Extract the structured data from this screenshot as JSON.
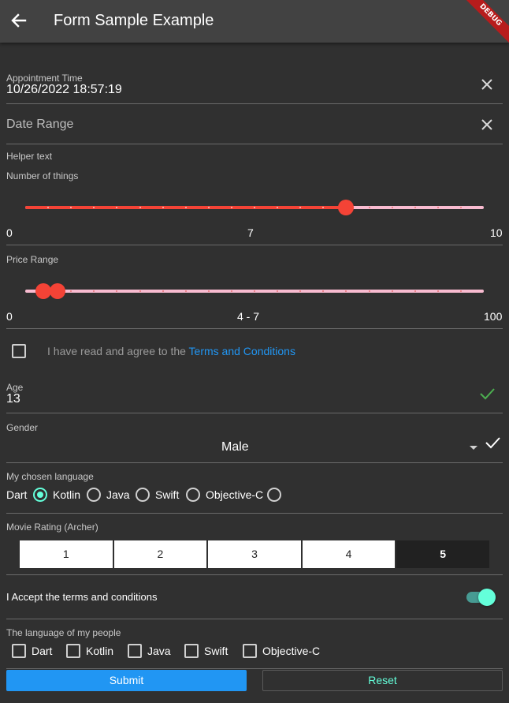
{
  "appbar": {
    "title": "Form Sample Example",
    "debug_label": "DEBUG"
  },
  "appointment": {
    "label": "Appointment Time",
    "value": "10/26/2022 18:57:19"
  },
  "date_range": {
    "placeholder": "Date Range",
    "helper": "Helper text"
  },
  "number_slider": {
    "label": "Number of things",
    "min_label": "0",
    "value_label": "7",
    "max_label": "10",
    "value": 7,
    "max": 10
  },
  "price_range": {
    "label": "Price Range",
    "min_label": "0",
    "value_label": "4 - 7",
    "max_label": "100",
    "low": 4,
    "high": 7,
    "max": 100
  },
  "terms": {
    "text": "I have read and agree to the ",
    "link": "Terms and Conditions"
  },
  "age": {
    "label": "Age",
    "value": "13"
  },
  "gender": {
    "label": "Gender",
    "value": "Male"
  },
  "language": {
    "label": "My chosen language",
    "options": [
      "Dart",
      "Kotlin",
      "Java",
      "Swift",
      "Objective-C"
    ],
    "selected": "Dart"
  },
  "rating": {
    "label": "Movie Rating (Archer)",
    "options": [
      "1",
      "2",
      "3",
      "4",
      "5"
    ],
    "selected": "5"
  },
  "accept_switch": {
    "label": "I Accept the terms and conditions",
    "on": true
  },
  "people_language": {
    "label": "The language of my people",
    "options": [
      "Dart",
      "Kotlin",
      "Java",
      "Swift",
      "Objective-C"
    ]
  },
  "buttons": {
    "submit": "Submit",
    "reset": "Reset"
  },
  "colors": {
    "accent": "#64ffda",
    "slider": "#f44336",
    "slider_inactive": "#f8bbd0",
    "primary": "#2196f3",
    "valid_check": "#4caf50"
  }
}
